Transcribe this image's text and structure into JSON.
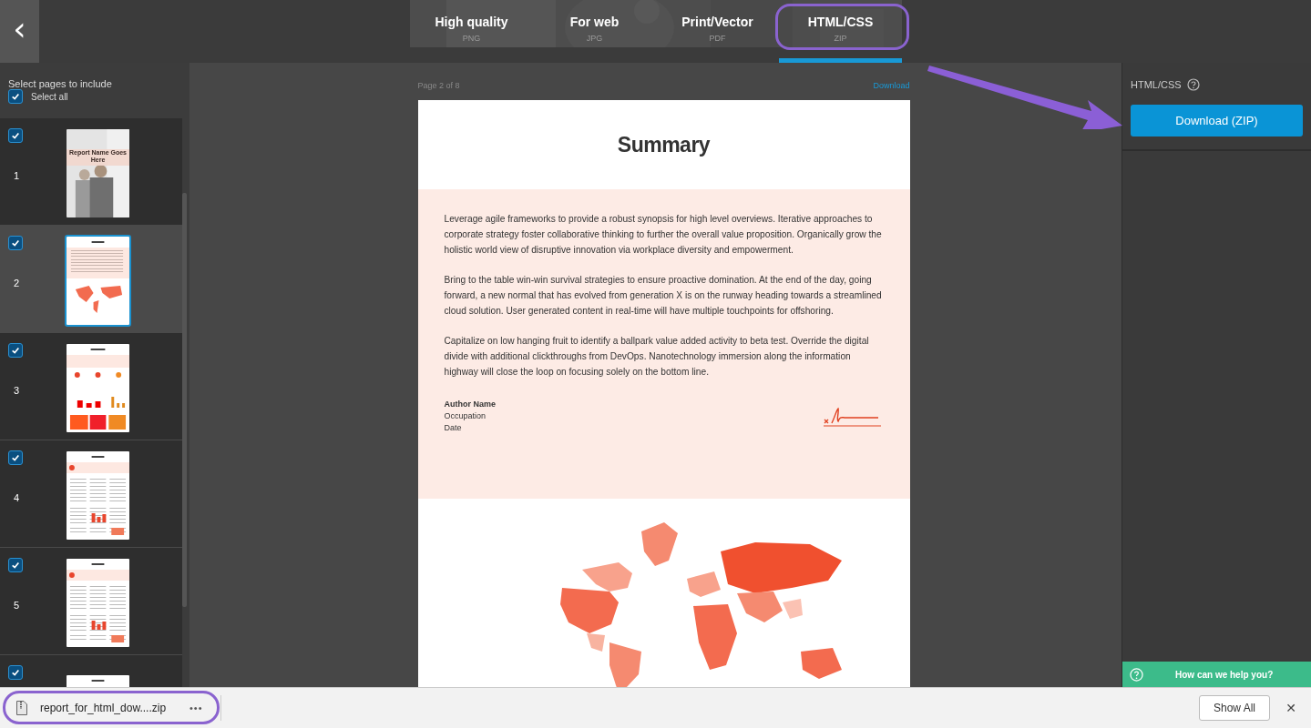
{
  "back_button": {
    "label": "‹"
  },
  "format_tabs": [
    {
      "label": "High quality",
      "sub": "PNG",
      "selected": false
    },
    {
      "label": "For web",
      "sub": "JPG",
      "selected": false
    },
    {
      "label": "Print/Vector",
      "sub": "PDF",
      "selected": false
    },
    {
      "label": "HTML/CSS",
      "sub": "ZIP",
      "selected": true
    }
  ],
  "sidebar": {
    "title": "Select pages to include",
    "select_all": {
      "label": "Select all",
      "checked": true
    },
    "pages": [
      {
        "number": "1",
        "checked": true,
        "selected": false,
        "kind": "cover",
        "title": "Report Name Goes Here"
      },
      {
        "number": "2",
        "checked": true,
        "selected": true,
        "kind": "summary"
      },
      {
        "number": "3",
        "checked": true,
        "selected": false,
        "kind": "comparison"
      },
      {
        "number": "4",
        "checked": true,
        "selected": false,
        "kind": "company"
      },
      {
        "number": "5",
        "checked": true,
        "selected": false,
        "kind": "company"
      },
      {
        "checked": true,
        "selected": false,
        "kind": "partial"
      }
    ]
  },
  "preview": {
    "page_label": "Page 2 of 8",
    "download_link": "Download",
    "title": "Summary",
    "paragraphs": [
      "Leverage agile frameworks to provide a robust synopsis for high level overviews. Iterative approaches to corporate strategy foster collaborative thinking to further the overall value proposition. Organically grow the holistic world view of disruptive innovation via workplace diversity and empowerment.",
      "Bring to the table win-win survival strategies to ensure proactive domination. At the end of the day, going forward, a new normal that has evolved from generation X is on the runway heading towards a streamlined cloud solution. User generated content in real-time will have multiple touchpoints for offshoring.",
      "Capitalize on low hanging fruit to identify a ballpark value added activity to beta test. Override the digital divide with additional clickthroughs from DevOps. Nanotechnology immersion along the information highway will close the loop on focusing solely on the bottom line."
    ],
    "author": {
      "name": "Author Name",
      "occupation": "Occupation",
      "date": "Date"
    }
  },
  "right_panel": {
    "heading": "HTML/CSS",
    "button": "Download (ZIP)",
    "help": "How can we help you?"
  },
  "download_bar": {
    "file": "report_for_html_dow....zip",
    "menu": "•••",
    "show_all": "Show All",
    "close": "✕"
  }
}
